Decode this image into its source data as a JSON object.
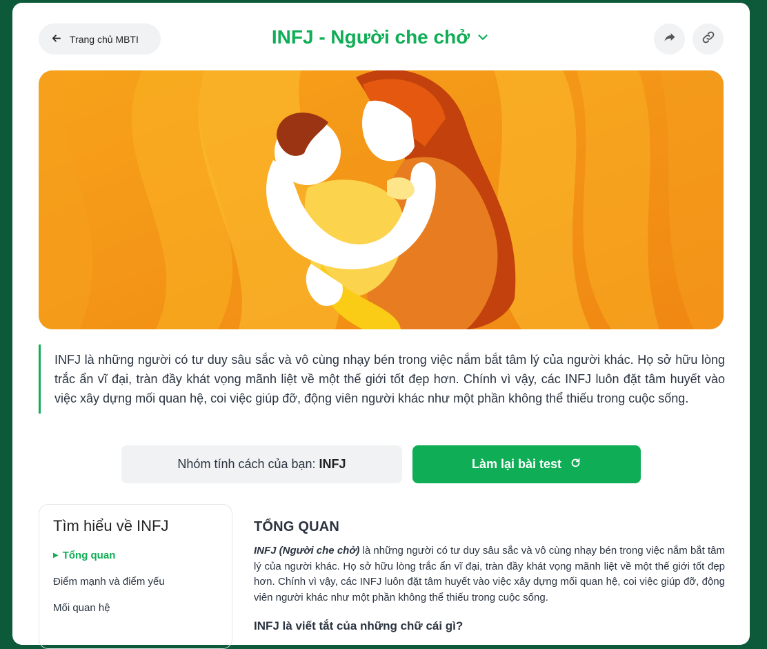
{
  "header": {
    "back_label": "Trang chủ MBTI",
    "title": "INFJ - Người che chở"
  },
  "quote": "INFJ là những người có tư duy sâu sắc và vô cùng nhạy bén trong việc nắm bắt tâm lý của người khác. Họ sở hữu lòng trắc ẩn vĩ đại, tràn đầy khát vọng mãnh liệt về một thế giới tốt đẹp hơn. Chính vì vậy, các INFJ luôn đặt tâm huyết vào việc xây dựng mối quan hệ, coi việc giúp đỡ, động viên người khác như một phần không thể thiếu trong cuộc sống.",
  "result": {
    "group_label": "Nhóm tính cách của bạn:",
    "group_value": "INFJ",
    "retake_label": "Làm lại bài test"
  },
  "toc": {
    "title": "Tìm hiểu về INFJ",
    "items": [
      {
        "label": "Tổng quan",
        "active": true
      },
      {
        "label": "Điểm mạnh và điểm yếu",
        "active": false
      },
      {
        "label": "Mối quan hệ",
        "active": false
      }
    ]
  },
  "content": {
    "section_title": "TỔNG QUAN",
    "lead": "INFJ (Người che chở)",
    "body": " là những người có tư duy sâu sắc và vô cùng nhạy bén trong việc nắm bắt tâm lý của người khác. Họ sở hữu lòng trắc ẩn vĩ đại, tràn đầy khát vọng mãnh liệt về một thế giới tốt đẹp hơn. Chính vì vậy, các INFJ luôn đặt tâm huyết vào việc xây dựng mối quan hệ, coi việc giúp đỡ, động viên người khác như một phần không thể thiếu trong cuộc sống.",
    "subheading": "INFJ là viết tắt của những chữ cái gì?"
  },
  "icons": {
    "back": "arrow-left-icon",
    "title_toggle": "chevron-down-icon",
    "share": "share-icon",
    "link": "link-icon",
    "retake": "refresh-icon"
  },
  "colors": {
    "accent": "#0fad55",
    "background": "#0d5a3a",
    "hero_orange": "#f39a12"
  }
}
